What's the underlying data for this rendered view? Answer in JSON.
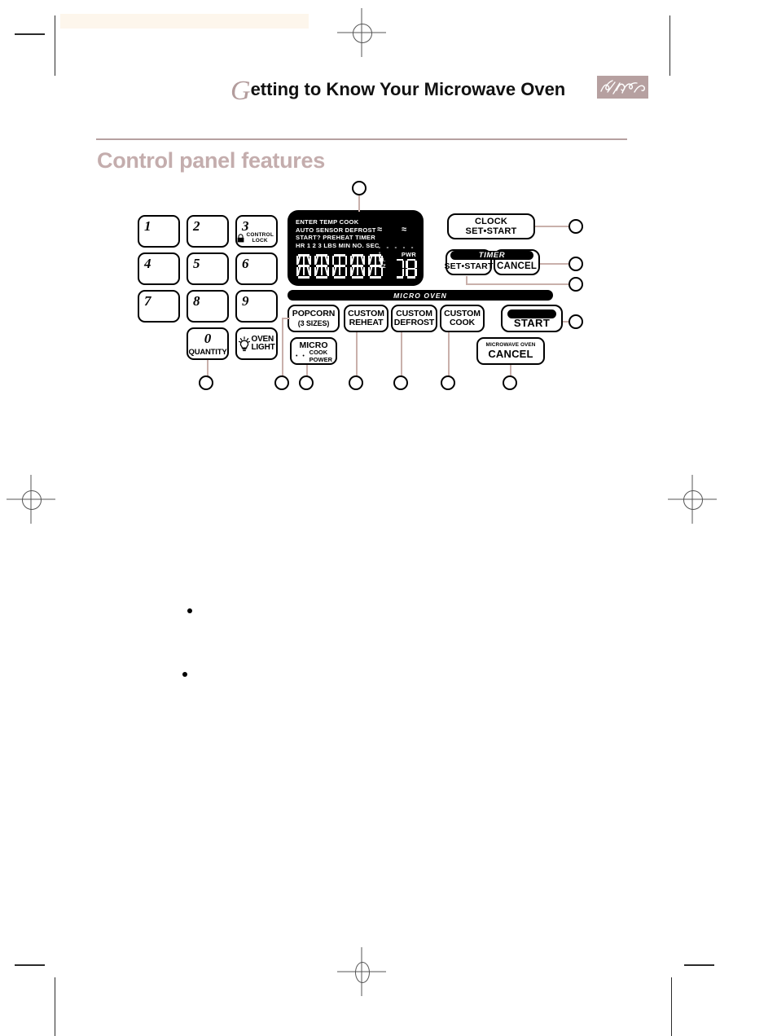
{
  "header": {
    "dropcap": "G",
    "title_rest": "etting to Know Your Microwave Oven",
    "signature_alt": "whirlpool-signature-mark"
  },
  "section": {
    "title": "Control panel features"
  },
  "keypad": {
    "keys": [
      "1",
      "2",
      "3",
      "4",
      "5",
      "6",
      "7",
      "8",
      "9"
    ],
    "control_lock_line1": "CONTROL",
    "control_lock_line2": "LOCK",
    "zero_key": "0",
    "quantity_label": "QUANTITY",
    "oven_light_line1": "OVEN",
    "oven_light_line2": "LIGHT"
  },
  "display": {
    "row1": "ENTER TEMP          COOK",
    "row2": "AUTO SENSOR  DEFROST",
    "row3": "START?  PREHEAT  TIMER",
    "row4": "HR 1 2 3 LBS MIN  NO. SEC",
    "wave_left": "≈",
    "wave_right": "≈",
    "dashes": "- - - - -",
    "unit_degree": "°",
    "unit_in": "IN.",
    "unit_oz": "OZ",
    "pwr_label": "PWR",
    "main_digits": "88888",
    "power_digits": "18"
  },
  "right_buttons": {
    "clock_line1": "CLOCK",
    "clock_line2": "SET•START",
    "timer_banner": "TIMER",
    "timer_set_start": "SET•START",
    "timer_cancel": "CANCEL"
  },
  "micro_oven": {
    "banner": "MICRO OVEN",
    "popcorn_line1": "POPCORN",
    "popcorn_line2": "(3 SIZES)",
    "custom_reheat_line1": "CUSTOM",
    "custom_reheat_line2": "REHEAT",
    "custom_defrost_line1": "CUSTOM",
    "custom_defrost_line2": "DEFROST",
    "custom_cook_line1": "CUSTOM",
    "custom_cook_line2": "COOK",
    "micro_line1": "MICRO",
    "micro_line2": "COOK",
    "micro_line3": "POWER",
    "micro_dots": "• •",
    "start_label": "START",
    "cancel_small": "MICROWAVE OVEN",
    "cancel_big": "CANCEL"
  },
  "callouts": {
    "bubbles": [
      "",
      "",
      "",
      "",
      "",
      "",
      "",
      "",
      "",
      "",
      "",
      ""
    ]
  },
  "body": {
    "bullet1": "",
    "bullet2": ""
  },
  "colors": {
    "accent_mauve": "#b6a0a0",
    "heading_mauve": "#c4adad",
    "leader_line": "#c9b0ab",
    "tint": "#fdf6ec",
    "ink": "#000000"
  }
}
